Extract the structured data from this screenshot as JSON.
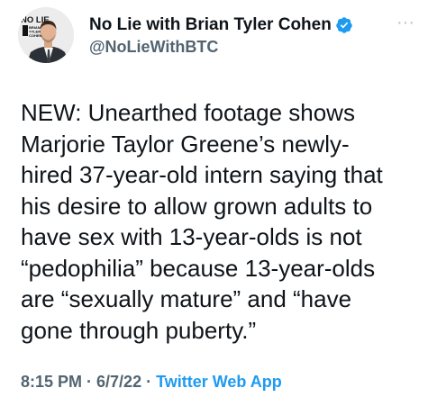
{
  "author": {
    "name": "No Lie with Brian Tyler Cohen",
    "handle": "@NoLieWithBTC",
    "avatar_text": [
      "NO LIE",
      "BRIAN",
      "TYLER",
      "COHEN"
    ]
  },
  "tweet": {
    "lines": [
      "NEW: Unearthed footage shows",
      "Marjorie Taylor Greene’s newly-",
      "hired 37-year-old intern saying that",
      "his desire to allow grown adults to",
      "have sex with 13-year-olds is not",
      "“pedophilia” because 13-year-olds",
      "are “sexually mature” and “have",
      "gone through puberty.”"
    ]
  },
  "meta": {
    "time": "8:15 PM",
    "sep1": " · ",
    "date": "6/7/22",
    "sep2": " · ",
    "app": "Twitter Web App"
  },
  "colors": {
    "verified": "#1d9bf0",
    "link": "#1d9bf0",
    "secondary_text": "#536471"
  },
  "icons": {
    "verified": "verified-badge-icon",
    "more": "more-options-icon"
  }
}
